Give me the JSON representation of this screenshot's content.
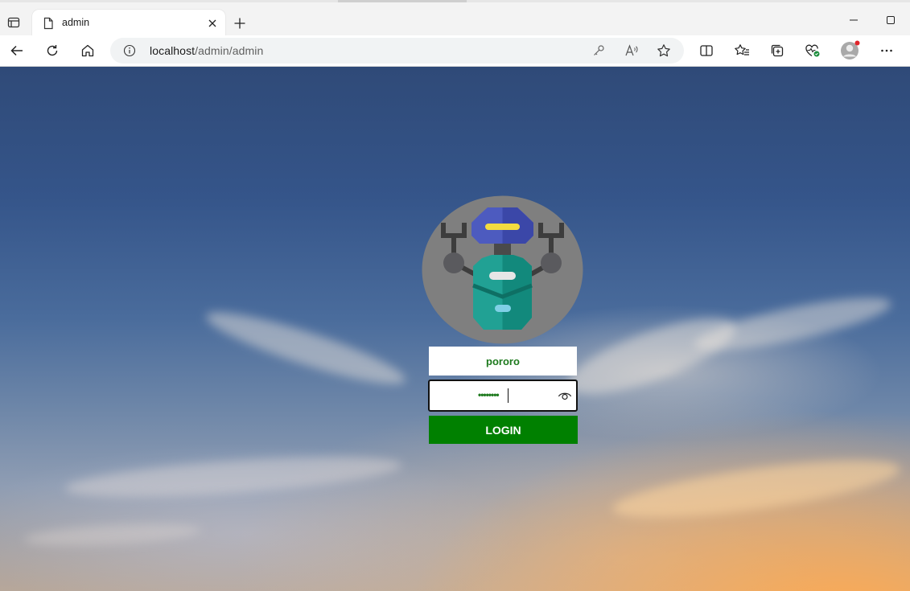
{
  "browser": {
    "tab_title": "admin",
    "url_host": "localhost",
    "url_path": "/admin/admin",
    "icons": {
      "tab_actions": "tab-actions-icon",
      "page": "page-icon",
      "close": "close-icon",
      "new_tab": "plus-icon",
      "back": "back-arrow-icon",
      "refresh": "refresh-icon",
      "home": "home-icon",
      "info": "info-icon",
      "key": "key-icon",
      "read_aloud": "read-aloud-icon",
      "favorite": "star-icon",
      "split": "split-screen-icon",
      "favorites": "favorites-list-icon",
      "collections": "collections-icon",
      "health": "browser-essentials-icon",
      "profile": "profile-avatar-icon",
      "more": "more-icon"
    }
  },
  "login": {
    "username_value": "pororo",
    "password_mask": "••••••••",
    "button_label": "LOGIN",
    "accent_color": "#008000"
  }
}
